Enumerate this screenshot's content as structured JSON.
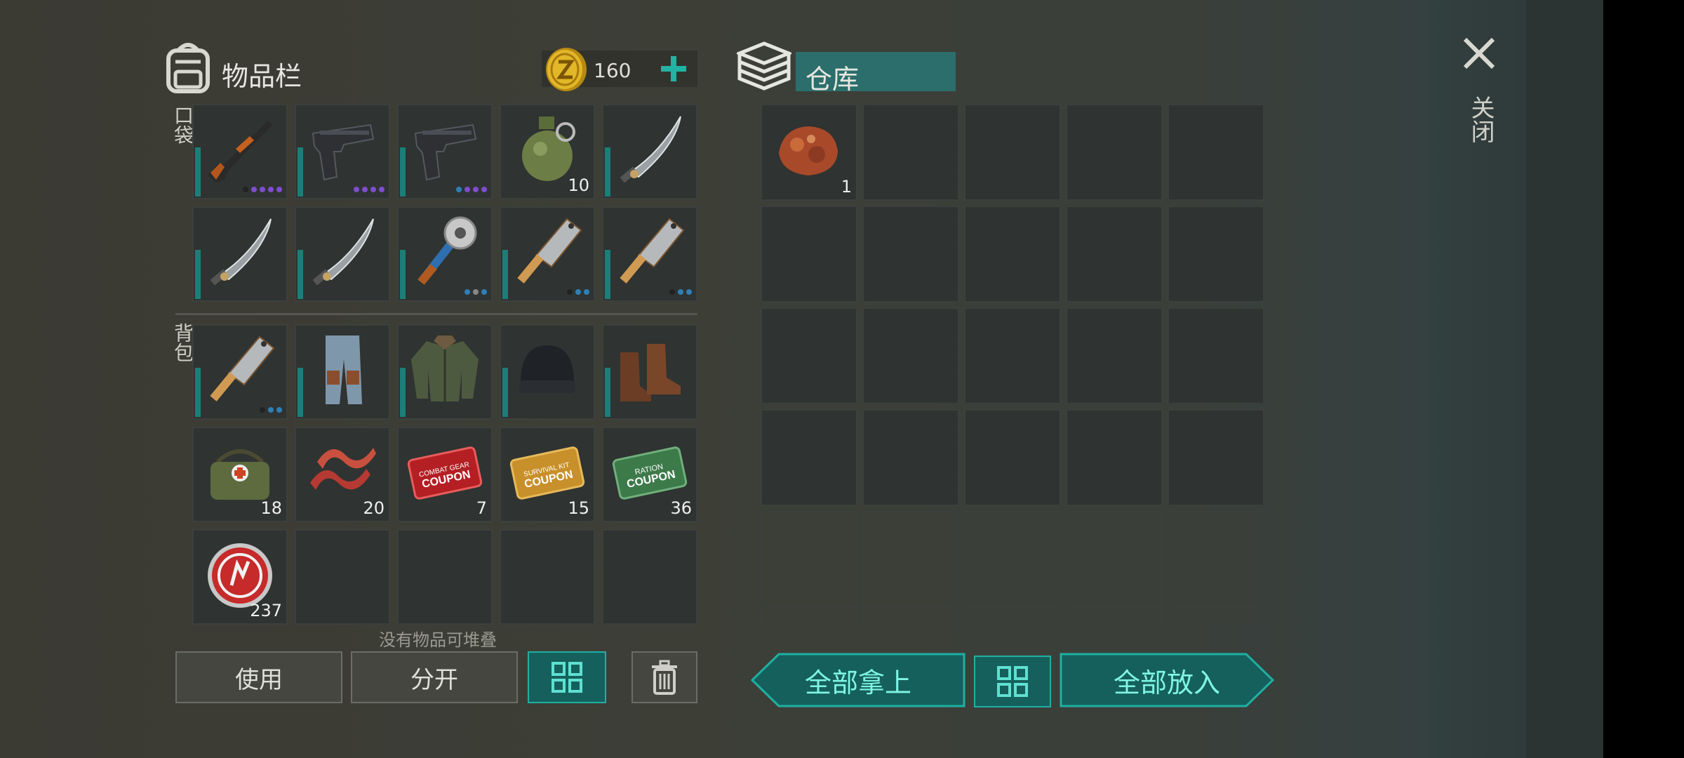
{
  "inventory": {
    "title": "物品栏",
    "coins": "160",
    "pocket_label": "口袋",
    "bag_label": "背包",
    "no_stack_hint": "没有物品可堆叠",
    "use_label": "使用",
    "split_label": "分开"
  },
  "pocket_items": [
    {
      "name": "shotgun",
      "qty": "",
      "dots": [
        "dark",
        "purple",
        "purple",
        "purple",
        "purple"
      ]
    },
    {
      "name": "pistol",
      "qty": "",
      "dots": [
        "purple",
        "purple",
        "purple",
        "purple"
      ]
    },
    {
      "name": "pistol",
      "qty": "",
      "dots": [
        "blue",
        "purple",
        "purple",
        "purple"
      ]
    },
    {
      "name": "grenade",
      "qty": "10",
      "dots": []
    },
    {
      "name": "machete",
      "qty": "",
      "dots": []
    },
    {
      "name": "machete",
      "qty": "",
      "dots": []
    },
    {
      "name": "machete",
      "qty": "",
      "dots": []
    },
    {
      "name": "saw-club",
      "qty": "",
      "dots": [
        "blue",
        "grey",
        "blue"
      ]
    },
    {
      "name": "cleaver",
      "qty": "",
      "dots": [
        "dark",
        "blue",
        "blue"
      ]
    },
    {
      "name": "cleaver",
      "qty": "",
      "dots": [
        "dark",
        "blue",
        "blue"
      ]
    }
  ],
  "bag_items": [
    {
      "name": "cleaver",
      "qty": "",
      "dots": [
        "dark",
        "blue",
        "blue"
      ]
    },
    {
      "name": "pants",
      "qty": "",
      "dots": []
    },
    {
      "name": "jacket",
      "qty": "",
      "dots": []
    },
    {
      "name": "beanie",
      "qty": "",
      "dots": []
    },
    {
      "name": "boots",
      "qty": "",
      "dots": []
    },
    {
      "name": "medkit-bag",
      "qty": "18",
      "dots": []
    },
    {
      "name": "bacon",
      "qty": "20",
      "dots": []
    },
    {
      "name": "combat-gear-coupon",
      "qty": "7",
      "dots": []
    },
    {
      "name": "survival-kit-coupon",
      "qty": "15",
      "dots": []
    },
    {
      "name": "ration-coupon",
      "qty": "36",
      "dots": []
    },
    {
      "name": "bottle-cap",
      "qty": "237",
      "dots": []
    },
    {
      "name": "empty",
      "qty": "",
      "dots": []
    },
    {
      "name": "empty",
      "qty": "",
      "dots": []
    },
    {
      "name": "empty",
      "qty": "",
      "dots": []
    },
    {
      "name": "empty",
      "qty": "",
      "dots": []
    }
  ],
  "warehouse": {
    "title": "仓库",
    "first_item_qty": "1",
    "take_all": "全部拿上",
    "put_all": "全部放入"
  },
  "close_label": "关闭",
  "colors": {
    "accent": "#1fb0a3",
    "teal_text": "#7ff5e6",
    "purple": "#7e4dd0",
    "blue": "#2f7fb7"
  },
  "coupon_text": {
    "combat": [
      "COMBAT GEAR",
      "COUPON"
    ],
    "survival": [
      "SURVIVAL KIT",
      "COUPON"
    ],
    "ration": [
      "RATION",
      "COUPON"
    ]
  }
}
